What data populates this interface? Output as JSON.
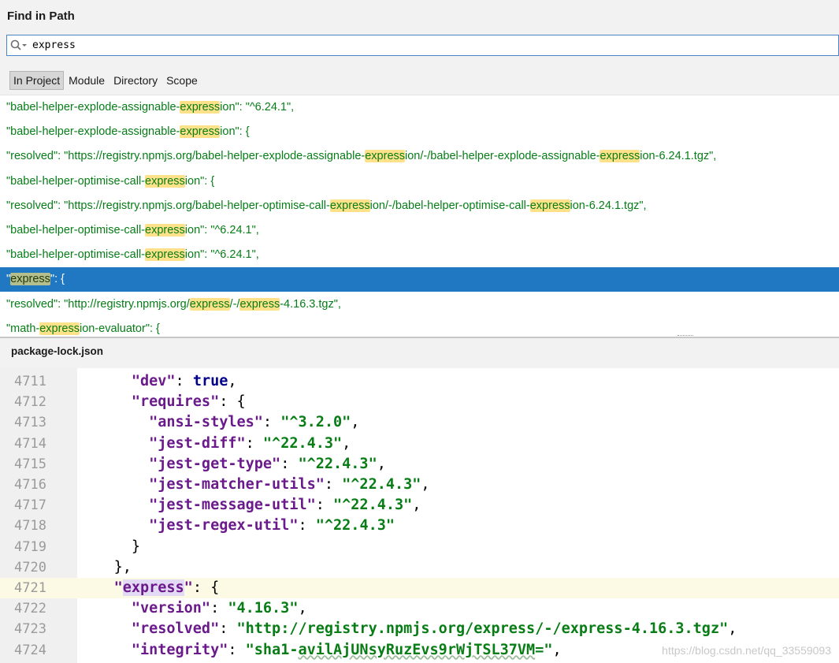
{
  "dialog": {
    "title": "Find in Path"
  },
  "search": {
    "value": "express"
  },
  "scopes": [
    {
      "label": "In Project",
      "active": true
    },
    {
      "label": "Module",
      "active": false
    },
    {
      "label": "Directory",
      "active": false
    },
    {
      "label": "Scope",
      "active": false
    }
  ],
  "results": [
    {
      "segments": [
        "\"babel-helper-explode-assignable-",
        "express",
        "ion\": \"^6.24.1\","
      ],
      "selected": false
    },
    {
      "segments": [
        "\"babel-helper-explode-assignable-",
        "express",
        "ion\": {"
      ],
      "selected": false
    },
    {
      "segments": [
        "\"resolved\": \"https://registry.npmjs.org/babel-helper-explode-assignable-",
        "express",
        "ion/-/babel-helper-explode-assignable-",
        "express",
        "ion-6.24.1.tgz\","
      ],
      "selected": false
    },
    {
      "segments": [
        "\"babel-helper-optimise-call-",
        "express",
        "ion\": {"
      ],
      "selected": false
    },
    {
      "segments": [
        "\"resolved\": \"https://registry.npmjs.org/babel-helper-optimise-call-",
        "express",
        "ion/-/babel-helper-optimise-call-",
        "express",
        "ion-6.24.1.tgz\","
      ],
      "selected": false
    },
    {
      "segments": [
        "\"babel-helper-optimise-call-",
        "express",
        "ion\": \"^6.24.1\","
      ],
      "selected": false
    },
    {
      "segments": [
        "\"babel-helper-optimise-call-",
        "express",
        "ion\": \"^6.24.1\","
      ],
      "selected": false
    },
    {
      "segments": [
        "\"",
        "express",
        "\": {"
      ],
      "selected": true
    },
    {
      "segments": [
        "\"resolved\": \"http://registry.npmjs.org/",
        "express",
        "/-/",
        "express",
        "-4.16.3.tgz\","
      ],
      "selected": false
    },
    {
      "segments": [
        "\"math-",
        "express",
        "ion-evaluator\": {"
      ],
      "selected": false
    }
  ],
  "preview": {
    "filename": "package-lock.json",
    "current_line": "4721",
    "lines": [
      {
        "num": "4711",
        "indent": "      ",
        "parts": [
          [
            "k",
            "\"dev\""
          ],
          [
            "p",
            ": "
          ],
          [
            "kw",
            "true"
          ],
          [
            "p",
            ","
          ]
        ]
      },
      {
        "num": "4712",
        "indent": "      ",
        "parts": [
          [
            "k",
            "\"requires\""
          ],
          [
            "p",
            ": {"
          ]
        ]
      },
      {
        "num": "4713",
        "indent": "        ",
        "parts": [
          [
            "k",
            "\"ansi-styles\""
          ],
          [
            "p",
            ": "
          ],
          [
            "s",
            "\"^3.2.0\""
          ],
          [
            "p",
            ","
          ]
        ]
      },
      {
        "num": "4714",
        "indent": "        ",
        "parts": [
          [
            "k",
            "\"jest-diff\""
          ],
          [
            "p",
            ": "
          ],
          [
            "s",
            "\"^22.4.3\""
          ],
          [
            "p",
            ","
          ]
        ]
      },
      {
        "num": "4715",
        "indent": "        ",
        "parts": [
          [
            "k",
            "\"jest-get-type\""
          ],
          [
            "p",
            ": "
          ],
          [
            "s",
            "\"^22.4.3\""
          ],
          [
            "p",
            ","
          ]
        ]
      },
      {
        "num": "4716",
        "indent": "        ",
        "parts": [
          [
            "k",
            "\"jest-matcher-utils\""
          ],
          [
            "p",
            ": "
          ],
          [
            "s",
            "\"^22.4.3\""
          ],
          [
            "p",
            ","
          ]
        ]
      },
      {
        "num": "4717",
        "indent": "        ",
        "parts": [
          [
            "k",
            "\"jest-message-util\""
          ],
          [
            "p",
            ": "
          ],
          [
            "s",
            "\"^22.4.3\""
          ],
          [
            "p",
            ","
          ]
        ]
      },
      {
        "num": "4718",
        "indent": "        ",
        "parts": [
          [
            "k",
            "\"jest-regex-util\""
          ],
          [
            "p",
            ": "
          ],
          [
            "s",
            "\"^22.4.3\""
          ]
        ]
      },
      {
        "num": "4719",
        "indent": "      ",
        "parts": [
          [
            "p",
            "}"
          ]
        ]
      },
      {
        "num": "4720",
        "indent": "    ",
        "parts": [
          [
            "p",
            "},"
          ]
        ]
      },
      {
        "num": "4721",
        "indent": "    ",
        "parts": [
          [
            "k",
            "\""
          ],
          [
            "hl",
            "express"
          ],
          [
            "k",
            "\""
          ],
          [
            "p",
            ": {"
          ]
        ]
      },
      {
        "num": "4722",
        "indent": "      ",
        "parts": [
          [
            "k",
            "\"version\""
          ],
          [
            "p",
            ": "
          ],
          [
            "s",
            "\"4.16.3\""
          ],
          [
            "p",
            ","
          ]
        ]
      },
      {
        "num": "4723",
        "indent": "      ",
        "parts": [
          [
            "k",
            "\"resolved\""
          ],
          [
            "p",
            ": "
          ],
          [
            "s",
            "\"http://registry.npmjs.org/express/-/express-4.16.3.tgz\""
          ],
          [
            "p",
            ","
          ]
        ]
      },
      {
        "num": "4724",
        "indent": "      ",
        "parts": [
          [
            "k",
            "\"integrity\""
          ],
          [
            "p",
            ": "
          ],
          [
            "s",
            "\"sha1-"
          ],
          [
            "sq",
            "avilAjUNsyRuzEvs9rWjTSL37VM"
          ],
          [
            "s",
            "=\""
          ],
          [
            "p",
            ","
          ]
        ]
      }
    ]
  },
  "watermark": "https://blog.csdn.net/qq_33559093",
  "colors": {
    "selection": "#1f78c1",
    "match_highlight": "#ffe18a",
    "key": "#6b1a8b",
    "string": "#087d16",
    "keyword": "#00008a"
  }
}
